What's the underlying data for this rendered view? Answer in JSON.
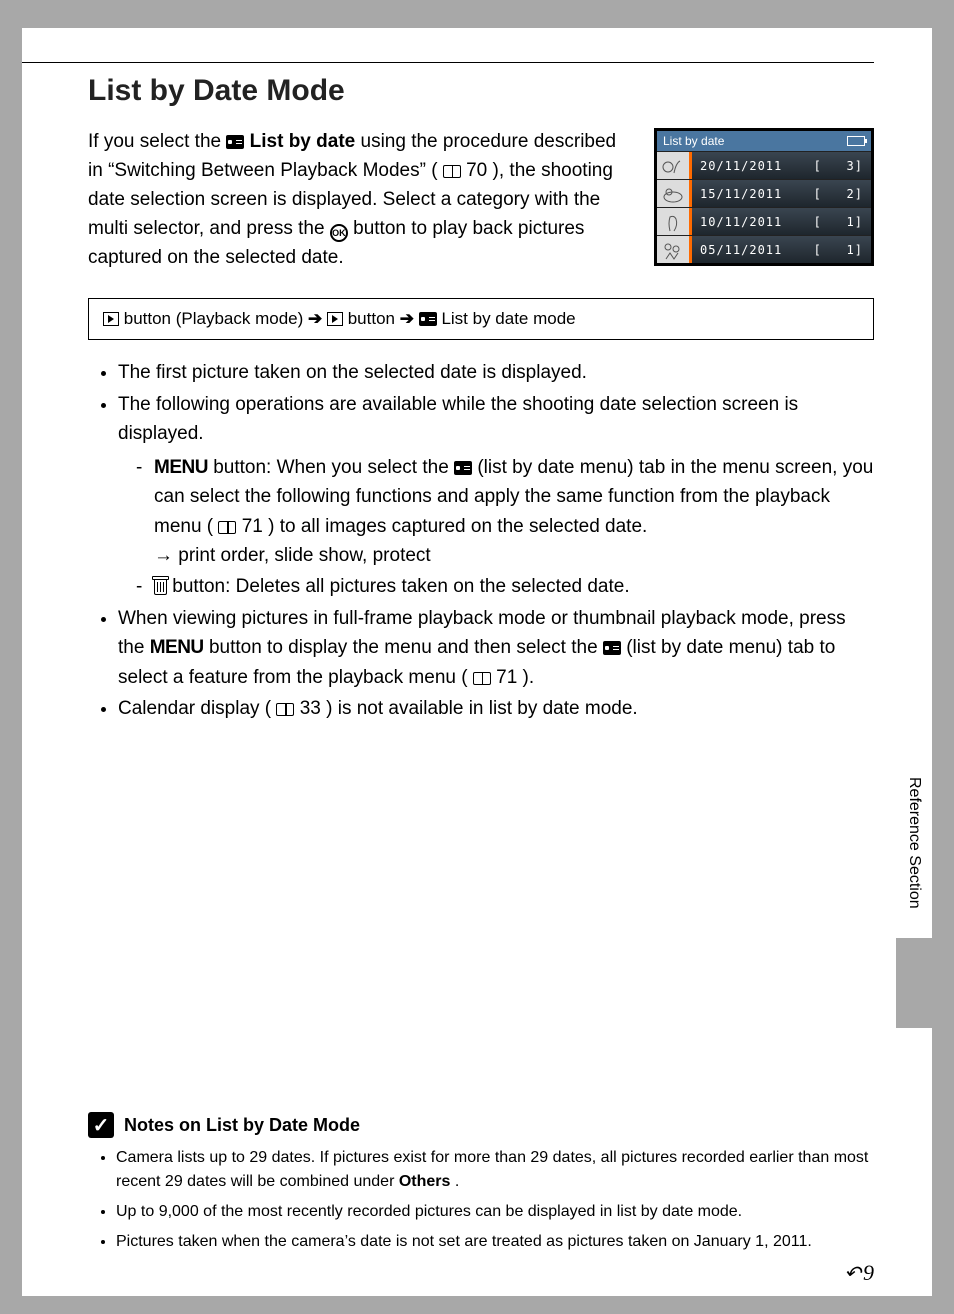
{
  "title": "List by Date Mode",
  "intro": {
    "p1a": "If you select the ",
    "bold": "List by date",
    "p1b": " using the procedure described in “Switching Between Playback Modes” (",
    "ref1": "70",
    "p1c": "), the shooting date selection screen is displayed. Select a category with the multi selector, and press the ",
    "ok": "OK",
    "p1d": " button to play back pictures captured on the selected date."
  },
  "screen": {
    "title": "List by date",
    "rows": [
      {
        "date": "20/11/2011",
        "count": "3"
      },
      {
        "date": "15/11/2011",
        "count": "2"
      },
      {
        "date": "10/11/2011",
        "count": "1"
      },
      {
        "date": "05/11/2011",
        "count": "1"
      }
    ]
  },
  "navbox": {
    "a": " button (Playback mode) ",
    "b": " button ",
    "c": " List by date mode"
  },
  "bullets": {
    "b1": "The first picture taken on the selected date is displayed.",
    "b2": "The following operations are available while the shooting date selection screen is displayed.",
    "b2s1_menu": "MENU",
    "b2s1a": " button: When you select the ",
    "b2s1b": " (list by date menu) tab in the menu screen, you can select the following functions and apply the same function from the playback menu (",
    "b2s1_ref": "71",
    "b2s1c": ") to all images captured on the selected date.",
    "b2s1_arrow": "→ print order, slide show, protect",
    "b2s2": " button: Deletes all pictures taken on the selected date.",
    "b3a": "When viewing pictures in full-frame playback mode or thumbnail playback mode, press the ",
    "b3_menu": "MENU",
    "b3b": " button to display the menu and then select the ",
    "b3c": " (list by date menu) tab to select a feature from the playback menu (",
    "b3_ref": "71",
    "b3d": ").",
    "b4a": "Calendar display (",
    "b4_ref": "33",
    "b4b": ") is not available in list by date mode."
  },
  "side_tab": "Reference Section",
  "notes": {
    "heading": "Notes on List by Date Mode",
    "n1a": "Camera lists up to 29 dates. If pictures exist for more than 29 dates, all pictures recorded earlier than most recent 29 dates will be combined under ",
    "n1_bold": "Others",
    "n1b": ".",
    "n2": "Up to 9,000 of the most recently recorded pictures can be displayed in list by date mode.",
    "n3": "Pictures taken when the camera’s date is not set are treated as pictures taken on January 1, 2011."
  },
  "page_number": "9"
}
